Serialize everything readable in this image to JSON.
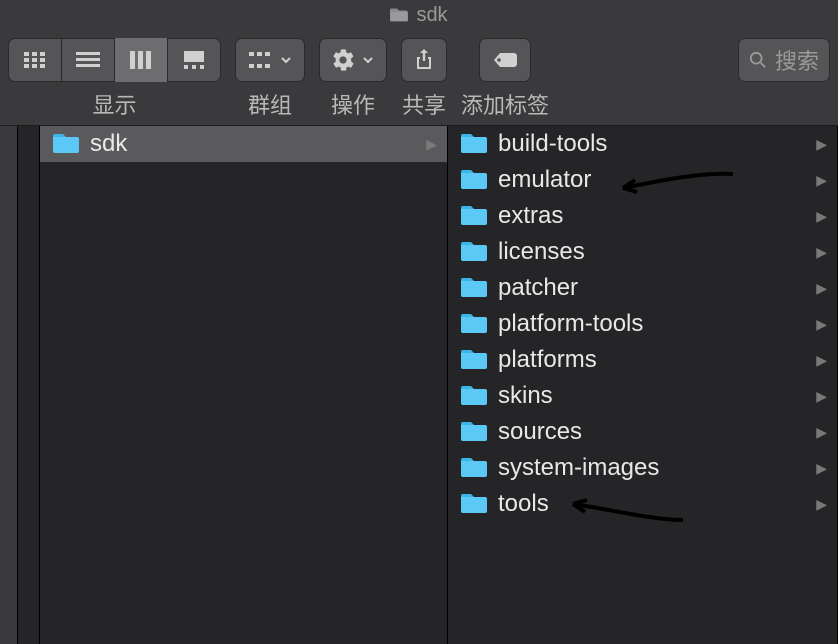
{
  "title": {
    "text": "sdk"
  },
  "toolbar": {
    "view_label": "显示",
    "group_label": "群组",
    "action_label": "操作",
    "share_label": "共享",
    "tag_label": "添加标签",
    "search_placeholder": "搜索"
  },
  "column2": {
    "items": [
      {
        "name": "sdk",
        "selected": true
      }
    ]
  },
  "column3": {
    "items": [
      {
        "name": "build-tools"
      },
      {
        "name": "emulator"
      },
      {
        "name": "extras"
      },
      {
        "name": "licenses"
      },
      {
        "name": "patcher"
      },
      {
        "name": "platform-tools"
      },
      {
        "name": "platforms"
      },
      {
        "name": "skins"
      },
      {
        "name": "sources"
      },
      {
        "name": "system-images"
      },
      {
        "name": "tools"
      }
    ]
  }
}
